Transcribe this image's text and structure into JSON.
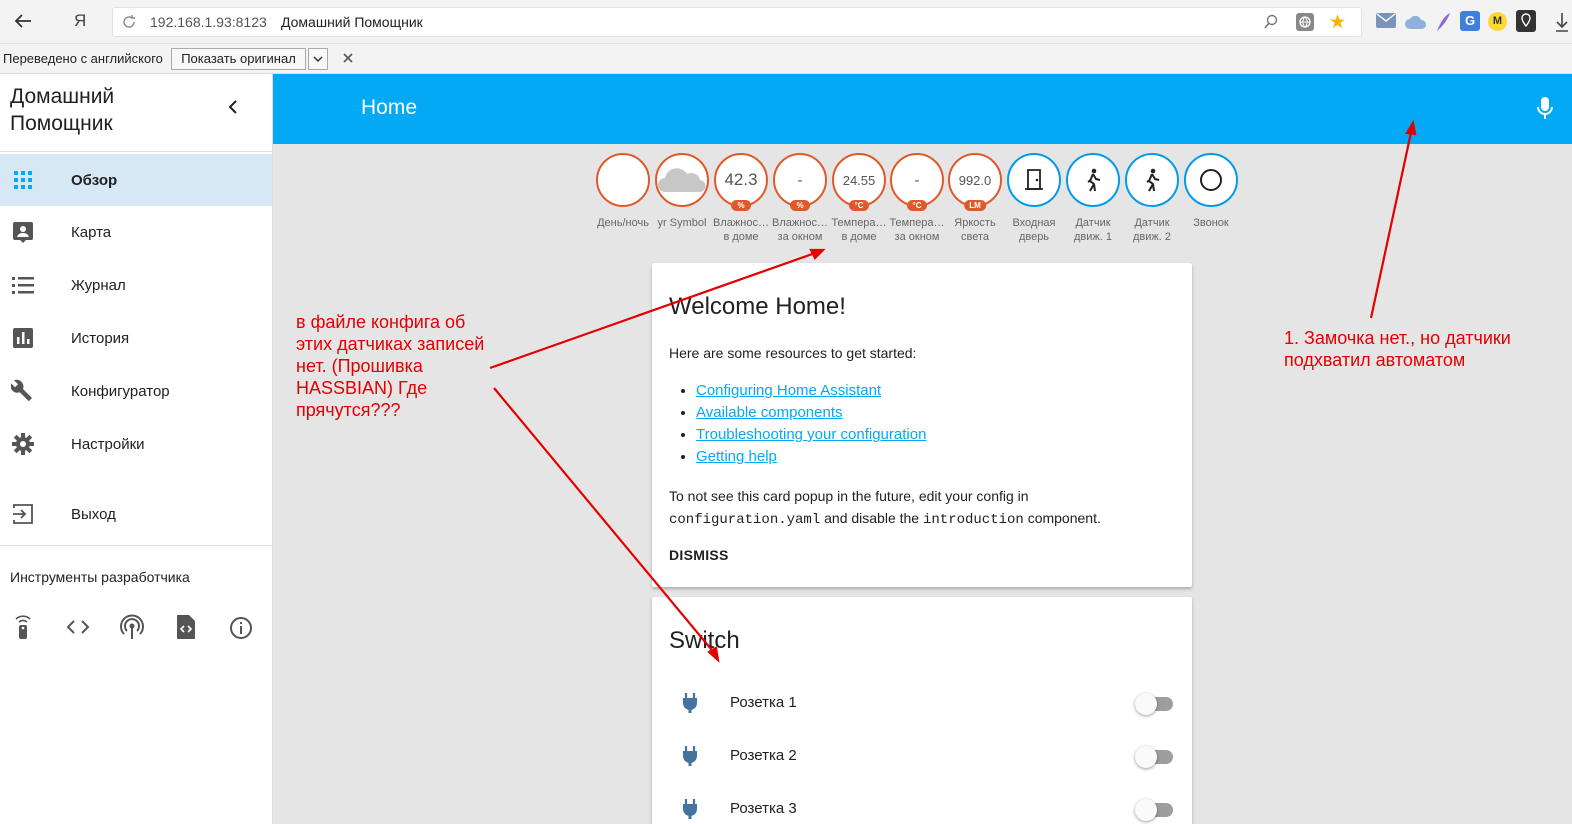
{
  "browser": {
    "url_host": "192.168.1.93:8123",
    "page_title": "Домашний Помощник",
    "yandex_glyph": "Я"
  },
  "translate_bar": {
    "message": "Переведено с английского",
    "show_original": "Показать оригинал"
  },
  "sidebar": {
    "title": "Домашний Помощник",
    "items": [
      {
        "label": "Обзор",
        "icon": "grid-icon",
        "active": true
      },
      {
        "label": "Карта",
        "icon": "map-person-icon"
      },
      {
        "label": "Журнал",
        "icon": "list-icon"
      },
      {
        "label": "История",
        "icon": "bar-chart-icon"
      },
      {
        "label": "Конфигуратор",
        "icon": "wrench-icon"
      },
      {
        "label": "Настройки",
        "icon": "gear-icon"
      }
    ],
    "logout": "Выход",
    "dev_tools_title": "Инструменты разработчика"
  },
  "topbar": {
    "title": "Home"
  },
  "badges": [
    {
      "value": "",
      "unit": "",
      "name1": "День/ночь",
      "name2": "",
      "icon": "moon-icon"
    },
    {
      "value": "",
      "unit": "",
      "name1": "yr Symbol",
      "name2": "",
      "icon": "cloud-icon"
    },
    {
      "value": "42.3",
      "unit": "%",
      "name1": "Влажнос…",
      "name2": "в доме"
    },
    {
      "value": "-",
      "unit": "%",
      "name1": "Влажнос…",
      "name2": "за окном"
    },
    {
      "value": "24.55",
      "unit": "°C",
      "name1": "Темпера…",
      "name2": "в доме"
    },
    {
      "value": "-",
      "unit": "°C",
      "name1": "Темпера…",
      "name2": "за окном"
    },
    {
      "value": "992.0",
      "unit": "LM",
      "name1": "Яркость",
      "name2": "света"
    },
    {
      "value": "",
      "unit": "",
      "name1": "Входная",
      "name2": "дверь",
      "icon": "door-icon"
    },
    {
      "value": "",
      "unit": "",
      "name1": "Датчик",
      "name2": "движ. 1",
      "icon": "walk-icon"
    },
    {
      "value": "",
      "unit": "",
      "name1": "Датчик",
      "name2": "движ. 2",
      "icon": "walk-icon"
    },
    {
      "value": "",
      "unit": "",
      "name1": "Звонок",
      "name2": "",
      "icon": "ring-icon"
    }
  ],
  "welcome": {
    "title": "Welcome Home!",
    "intro": "Here are some resources to get started:",
    "links": [
      "Configuring Home Assistant",
      "Available components",
      "Troubleshooting your configuration",
      "Getting help"
    ],
    "note_1": "To not see this card popup in the future, edit your config in",
    "note_code1": "configuration.yaml",
    "note_mid": " and disable the ",
    "note_code2": "introduction",
    "note_end": " component.",
    "dismiss": "DISMISS"
  },
  "switch_card": {
    "title": "Switch",
    "rows": [
      {
        "label": "Розетка 1",
        "on": false
      },
      {
        "label": "Розетка 2",
        "on": false
      },
      {
        "label": "Розетка 3",
        "on": false
      }
    ]
  },
  "annotations": {
    "left_1": "в файле  конфига об",
    "left_2": "этих датчиках записей",
    "left_3": "нет. (Прошивка",
    "left_4": "HASSBIAN) Где",
    "left_5": "прячутся???",
    "right_1": "1. Замочка нет., но датчики",
    "right_2": "подхватил автоматом"
  },
  "colors": {
    "accent": "#03a9f4",
    "badge_border": "#e0592a",
    "annotation": "#e30000"
  }
}
